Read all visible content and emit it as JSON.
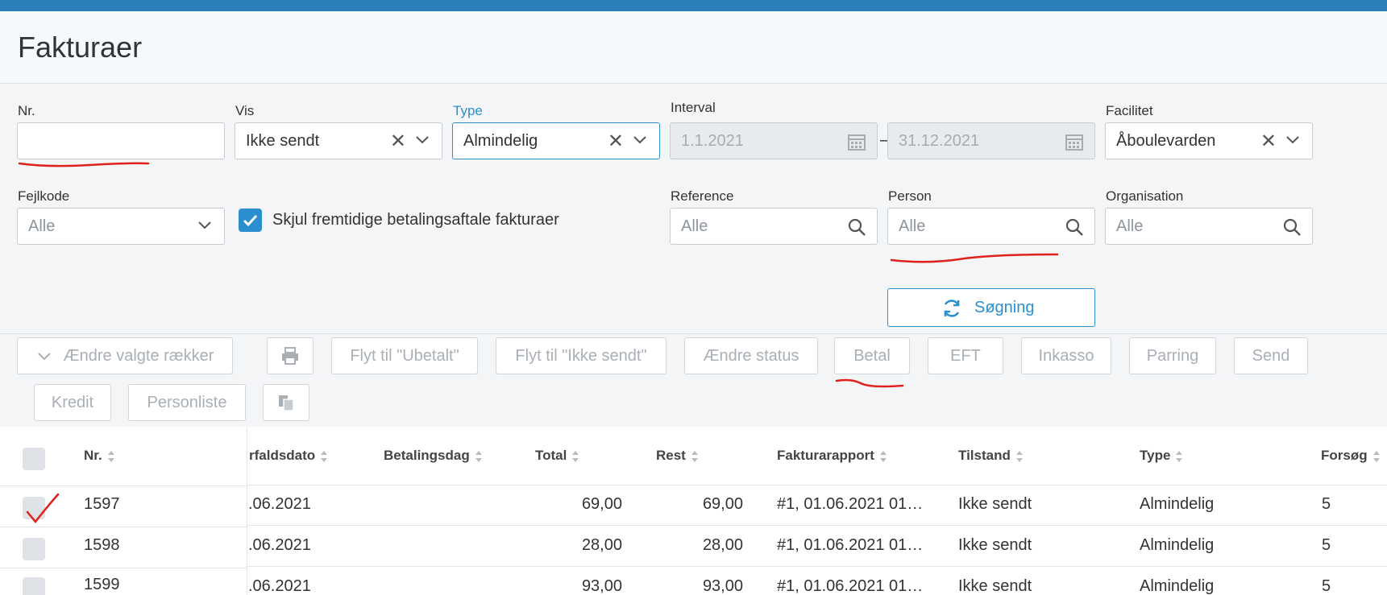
{
  "page": {
    "title": "Fakturaer"
  },
  "filters": {
    "nr": {
      "label": "Nr.",
      "value": ""
    },
    "vis": {
      "label": "Vis",
      "value": "Ikke sendt"
    },
    "type": {
      "label": "Type",
      "value": "Almindelig"
    },
    "interval": {
      "label": "Interval",
      "from": "1.1.2021",
      "to": "31.12.2021",
      "separator": "–"
    },
    "facilitet": {
      "label": "Facilitet",
      "value": "Åboulevarden"
    },
    "fejlkode": {
      "label": "Fejlkode",
      "placeholder": "Alle"
    },
    "hide_future": {
      "label": "Skjul fremtidige betalingsaftale fakturaer",
      "checked": true
    },
    "reference": {
      "label": "Reference",
      "placeholder": "Alle"
    },
    "person": {
      "label": "Person",
      "placeholder": "Alle"
    },
    "organisation": {
      "label": "Organisation",
      "placeholder": "Alle"
    },
    "search_button": "Søgning"
  },
  "toolbar": {
    "change_rows": "Ændre valgte rækker",
    "move_unpaid": "Flyt til \"Ubetalt\"",
    "move_not_sent": "Flyt til \"Ikke sendt\"",
    "change_status": "Ændre status",
    "pay": "Betal",
    "eft": "EFT",
    "collection": "Inkasso",
    "pairing": "Parring",
    "send": "Send",
    "credit": "Kredit",
    "person_list": "Personliste"
  },
  "table": {
    "columns": [
      "Nr.",
      "rfaldsdato",
      "Betalingsdag",
      "Total",
      "Rest",
      "Fakturarapport",
      "Tilstand",
      "Type",
      "Forsøg"
    ],
    "rows": [
      {
        "nr": "1597",
        "due": ".06.2021",
        "total": "69,00",
        "rest": "69,00",
        "report": "#1, 01.06.2021 01…",
        "state": "Ikke sendt",
        "type": "Almindelig",
        "attempts": "5"
      },
      {
        "nr": "1598",
        "due": ".06.2021",
        "total": "28,00",
        "rest": "28,00",
        "report": "#1, 01.06.2021 01…",
        "state": "Ikke sendt",
        "type": "Almindelig",
        "attempts": "5"
      },
      {
        "nr": "1599",
        "due": ".06.2021",
        "total": "93,00",
        "rest": "93,00",
        "report": "#1, 01.06.2021 01…",
        "state": "Ikke sendt",
        "type": "Almindelig",
        "attempts": "5"
      }
    ]
  },
  "colors": {
    "accent": "#2b8fcf",
    "topbar": "#2b7fb8",
    "annotation": "#e0201c"
  },
  "icons": [
    "chevron-down-icon",
    "clear-icon",
    "calendar-icon",
    "search-icon",
    "refresh-icon",
    "printer-icon",
    "copy-icon",
    "sort-icon",
    "checkmark-icon"
  ]
}
